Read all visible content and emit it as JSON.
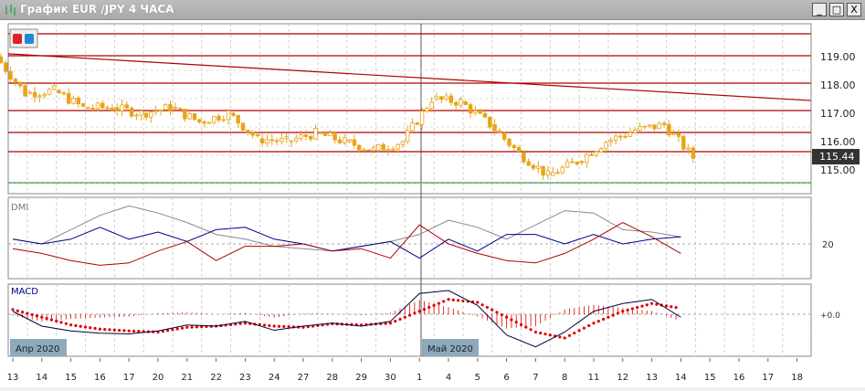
{
  "window": {
    "title": "График EUR /JPY  4 ЧАСА",
    "minimize": "_",
    "maximize": "□",
    "close": "X"
  },
  "colors": {
    "up": "#e8a317",
    "down": "#e8a317",
    "level": "#b00000",
    "support": "#1a8a1a",
    "adx": "#888888",
    "plus_di": "#00008b",
    "minus_di": "#b00000",
    "macd": "#00003a",
    "signal": "#e00000"
  },
  "price_axis": {
    "labels": [
      "119.00",
      "118.00",
      "117.00",
      "116.00",
      "115.00"
    ],
    "current": "115.44"
  },
  "dmi": {
    "label": "DMI",
    "level": "20"
  },
  "macd": {
    "label": "MACD",
    "zero": "+0.0"
  },
  "months": [
    "Апр 2020",
    "Май 2020"
  ],
  "chart_data": {
    "type": "candlestick",
    "title": "EUR/JPY 4H",
    "x": [
      "13",
      "14",
      "15",
      "16",
      "17",
      "20",
      "21",
      "22",
      "23",
      "24",
      "27",
      "28",
      "29",
      "30",
      "1",
      "4",
      "5",
      "6",
      "7",
      "8",
      "11",
      "12",
      "13",
      "14",
      "15",
      "16",
      "17",
      "18"
    ],
    "closes": [
      117.7,
      117.8,
      117.2,
      117.2,
      117.0,
      117.2,
      116.7,
      117.0,
      116.1,
      116.0,
      116.3,
      116.0,
      115.7,
      116.0,
      117.5,
      117.4,
      116.6,
      115.6,
      114.8,
      115.3,
      116.0,
      116.4,
      116.6,
      115.44
    ],
    "levels": [
      119.8,
      119.0,
      118.0,
      117.0,
      116.2,
      115.5
    ],
    "support": 114.6,
    "trendline": [
      119.1,
      117.45
    ],
    "ylim": [
      114.2,
      120.0
    ],
    "adx": [
      22,
      20,
      26,
      32,
      36,
      33,
      29,
      24,
      22,
      19,
      18,
      17,
      19,
      21,
      24,
      30,
      27,
      22,
      28,
      34,
      33,
      26,
      25,
      23
    ],
    "plus_di": [
      22,
      20,
      22,
      27,
      22,
      25,
      21,
      26,
      27,
      22,
      20,
      17,
      19,
      21,
      14,
      22,
      17,
      24,
      24,
      20,
      24,
      20,
      22,
      23
    ],
    "minus_di": [
      18,
      16,
      13,
      11,
      12,
      17,
      21,
      13,
      19,
      19,
      20,
      17,
      18,
      14,
      28,
      20,
      16,
      13,
      12,
      16,
      22,
      29,
      23,
      16
    ],
    "macd_line": [
      0.05,
      -0.2,
      -0.28,
      -0.32,
      -0.33,
      -0.28,
      -0.18,
      -0.2,
      -0.12,
      -0.27,
      -0.2,
      -0.15,
      -0.2,
      -0.12,
      0.35,
      0.4,
      0.15,
      -0.35,
      -0.55,
      -0.3,
      0.05,
      0.18,
      0.25,
      -0.05
    ],
    "signal_line": [
      0.08,
      -0.05,
      -0.18,
      -0.25,
      -0.28,
      -0.3,
      -0.22,
      -0.2,
      -0.15,
      -0.2,
      -0.22,
      -0.16,
      -0.18,
      -0.15,
      0.05,
      0.25,
      0.2,
      -0.05,
      -0.3,
      -0.4,
      -0.15,
      0.05,
      0.18,
      0.1
    ],
    "ylabel": "",
    "xlabel": ""
  }
}
